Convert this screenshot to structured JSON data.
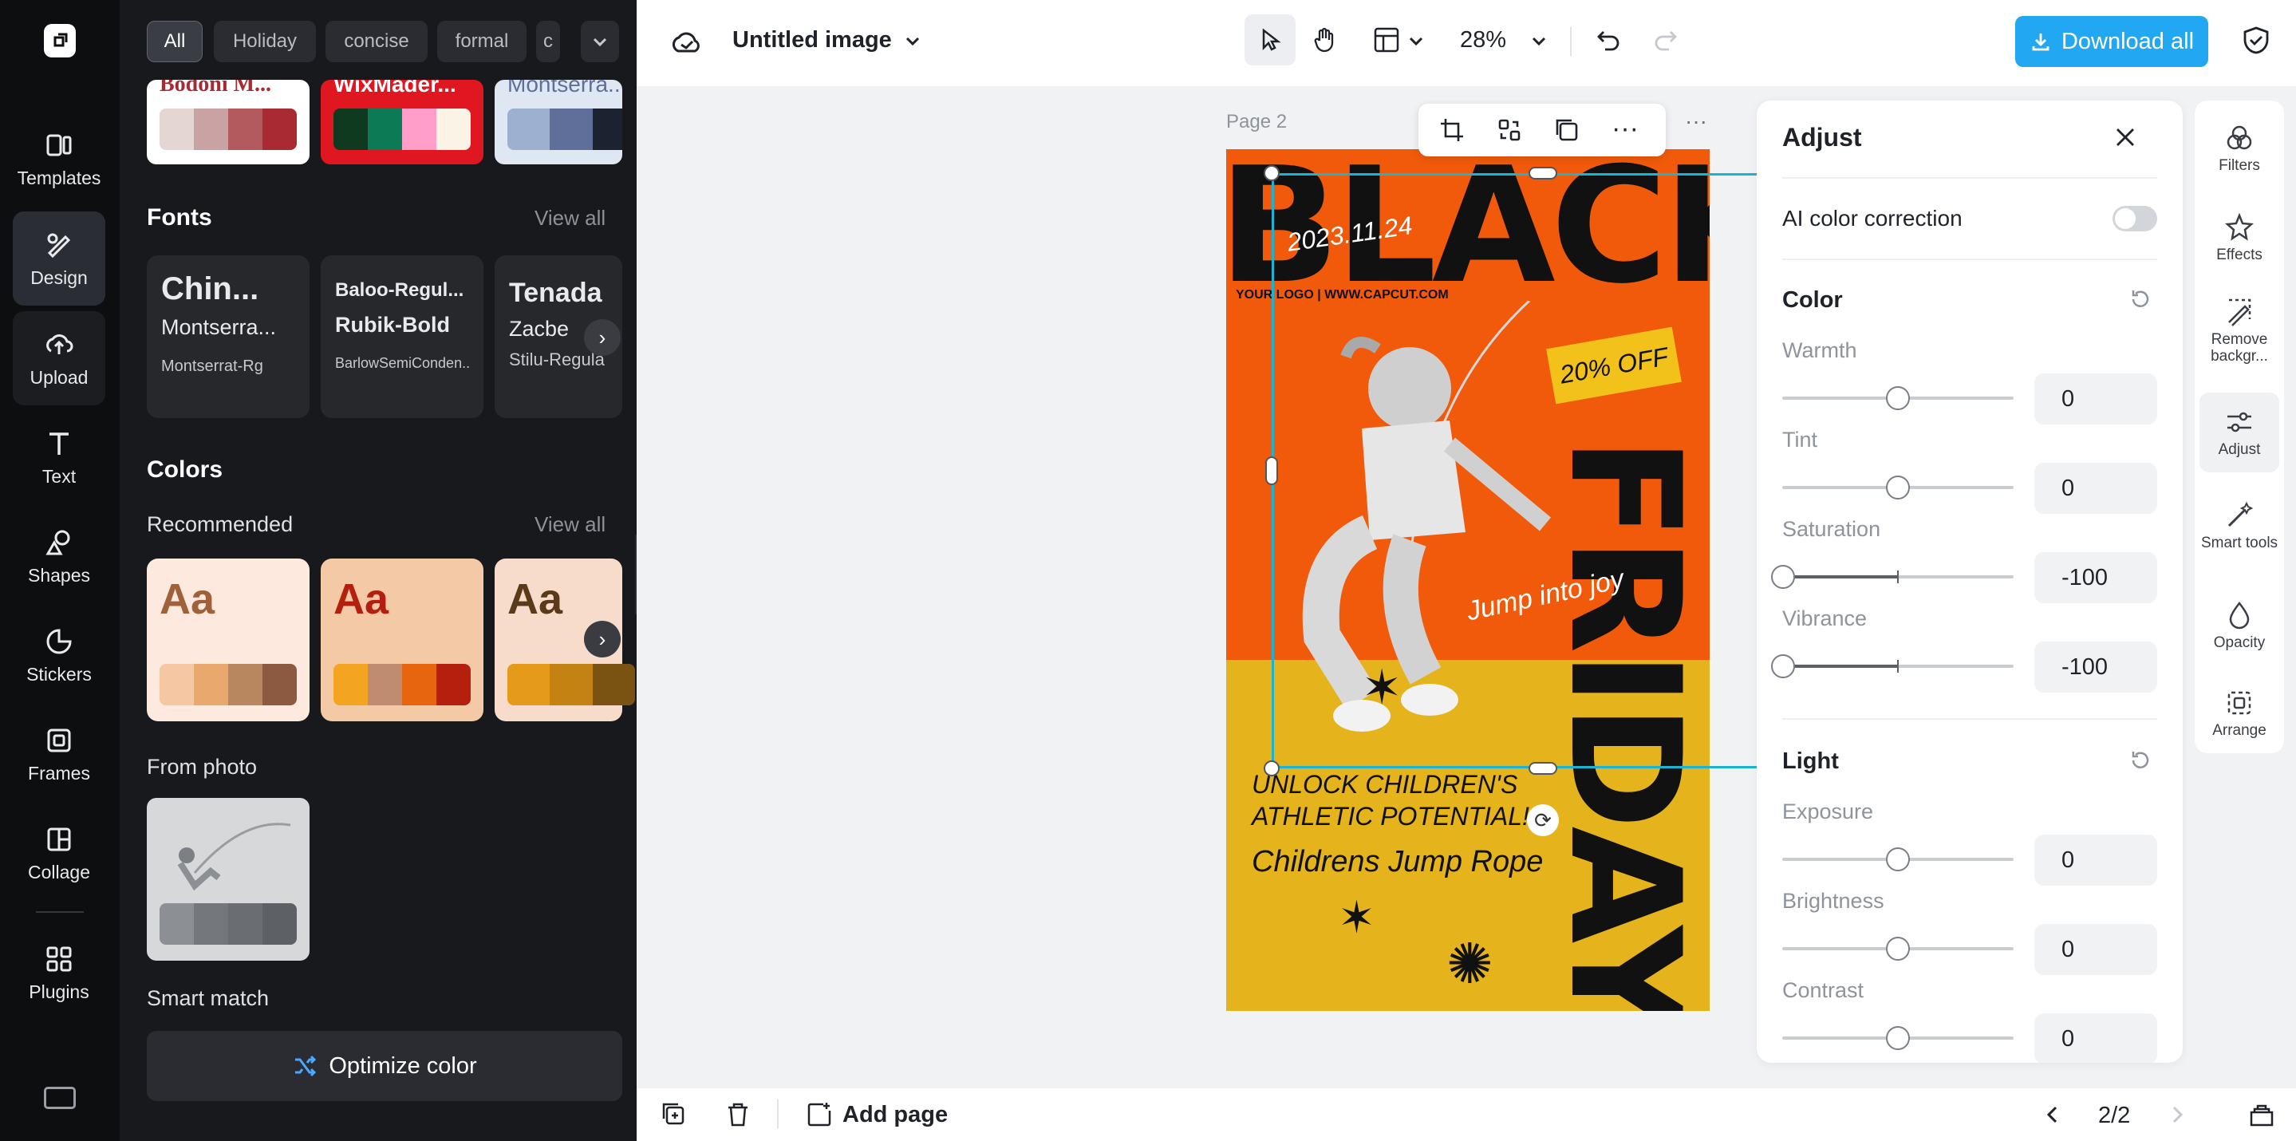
{
  "rail": {
    "items": [
      {
        "label": "Templates",
        "icon": "templates-icon"
      },
      {
        "label": "Design",
        "icon": "design-icon"
      },
      {
        "label": "Upload",
        "icon": "upload-icon"
      },
      {
        "label": "Text",
        "icon": "text-icon"
      },
      {
        "label": "Shapes",
        "icon": "shapes-icon"
      },
      {
        "label": "Stickers",
        "icon": "stickers-icon"
      },
      {
        "label": "Frames",
        "icon": "frames-icon"
      },
      {
        "label": "Collage",
        "icon": "collage-icon"
      },
      {
        "label": "Plugins",
        "icon": "plugins-icon"
      }
    ]
  },
  "panel": {
    "chips": [
      "All",
      "Holiday",
      "concise",
      "formal",
      "c"
    ],
    "top_palettes": [
      {
        "name": "Bodoni M...",
        "colors": [
          "#e4d6d3",
          "#c9a3a3",
          "#b35a5e",
          "#a92a33"
        ],
        "bg": "#ffffff",
        "name_color": "#a92a33"
      },
      {
        "name": "WixMader...",
        "colors": [
          "#0f3a1f",
          "#0b7a55",
          "#ff9fc9",
          "#faf3e6"
        ],
        "bg": "#e01620",
        "name_color": "#ffffff"
      },
      {
        "name": "Montserra...",
        "colors": [
          "#9db0cf",
          "#5f6f9a",
          "#1c2230"
        ],
        "bg": "#dfe7f3",
        "name_color": "#5f6f9a"
      }
    ],
    "fonts_title": "Fonts",
    "fonts_view_all": "View all",
    "font_cards": [
      {
        "l1": "Chin...",
        "l2": "Montserra...",
        "l3": "Montserrat-Rg"
      },
      {
        "l1": "Baloo-Regul...",
        "l2": "Rubik-Bold",
        "l3": "BarlowSemiConden..."
      },
      {
        "l1": "Tenada",
        "l2": "Zacbe",
        "l3": "Stilu-Regula"
      }
    ],
    "colors_title": "Colors",
    "recommended": "Recommended",
    "colors_view_all": "View all",
    "color_cards": [
      {
        "aa": "Aa",
        "bg": "#fde9de",
        "aa_color": "#a0603a",
        "colors": [
          "#f6c7a3",
          "#e9a86c",
          "#b8865f",
          "#8c5a41"
        ]
      },
      {
        "aa": "Aa",
        "bg": "#f3c9a6",
        "aa_color": "#b5200e",
        "colors": [
          "#f3a522",
          "#bf8c72",
          "#e8650f",
          "#b5200e"
        ]
      },
      {
        "aa": "Aa",
        "bg": "#f7dccc",
        "aa_color": "#5a3a18",
        "colors": [
          "#e59a1a",
          "#c48212",
          "#7a5212"
        ]
      }
    ],
    "from_photo": "From photo",
    "photo_colors": [
      "#8c8f93",
      "#74777c",
      "#6a6d72",
      "#5d6065"
    ],
    "smart_match": "Smart match",
    "optimize": "Optimize color"
  },
  "topbar": {
    "title": "Untitled image",
    "zoom": "28%",
    "download": "Download all"
  },
  "canvas": {
    "page_label": "Page 2"
  },
  "poster": {
    "black": "BLACK",
    "friday": "FRIDAY",
    "date": "2023.11.24",
    "logo": "YOUR LOGO  |  WWW.CAPCUT.COM",
    "discount": "20% OFF",
    "jump": "Jump into joy",
    "unlock1": "UNLOCK CHILDREN'S",
    "unlock2": "ATHLETIC POTENTIAL!",
    "product": "Childrens Jump Rope"
  },
  "adjust": {
    "title": "Adjust",
    "ai_label": "AI color correction",
    "color_head": "Color",
    "light_head": "Light",
    "color_rows": [
      {
        "label": "Warmth",
        "value": "0",
        "level": 0.5
      },
      {
        "label": "Tint",
        "value": "0",
        "level": 0.5
      },
      {
        "label": "Saturation",
        "value": "-100",
        "level": 0
      },
      {
        "label": "Vibrance",
        "value": "-100",
        "level": 0
      }
    ],
    "light_rows": [
      {
        "label": "Exposure",
        "value": "0",
        "level": 0.5
      },
      {
        "label": "Brightness",
        "value": "0",
        "level": 0.5
      },
      {
        "label": "Contrast",
        "value": "0",
        "level": 0.5
      }
    ]
  },
  "tools": [
    {
      "label": "Filters",
      "icon": "filters-icon"
    },
    {
      "label": "Effects",
      "icon": "effects-icon"
    },
    {
      "label": "Remove backgr...",
      "icon": "remove-background-icon"
    },
    {
      "label": "Adjust",
      "icon": "adjust-icon"
    },
    {
      "label": "Smart tools",
      "icon": "smart-tools-icon"
    },
    {
      "label": "Opacity",
      "icon": "opacity-icon"
    },
    {
      "label": "Arrange",
      "icon": "arrange-icon"
    }
  ],
  "bottombar": {
    "add_page": "Add page",
    "pages": "2/2"
  },
  "colors": {
    "accent": "#22a8f2",
    "selection": "#1bb3d4"
  }
}
